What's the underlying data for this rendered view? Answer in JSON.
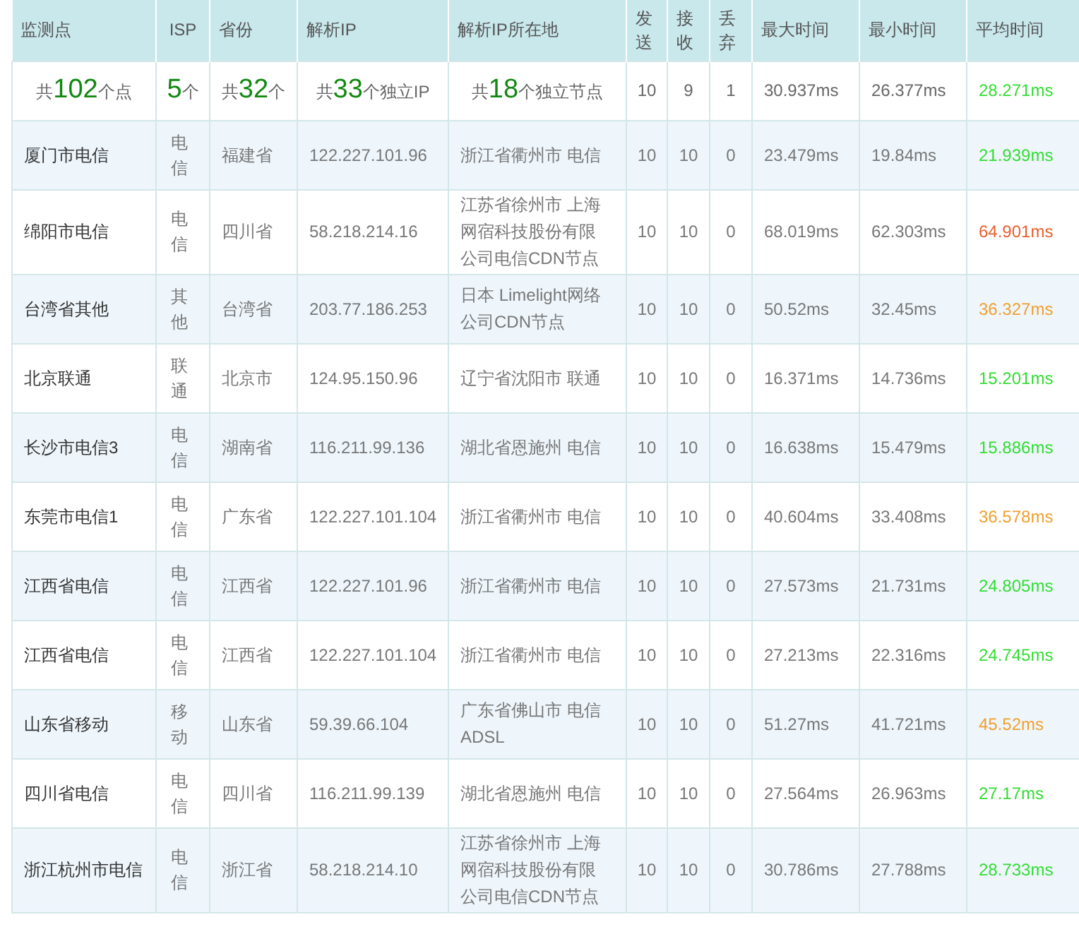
{
  "table": {
    "columns": [
      "监测点",
      "ISP",
      "省份",
      "解析IP",
      "解析IP所在地",
      "发送",
      "接收",
      "丢弃",
      "最大时间",
      "最小时间",
      "平均时间"
    ],
    "summary": {
      "points": {
        "prefix": "共",
        "count": "102",
        "suffix": "个点"
      },
      "isp": {
        "count": "5",
        "suffix": "个"
      },
      "provinces": {
        "prefix": "共",
        "count": "32",
        "suffix": "个"
      },
      "ips": {
        "prefix": "共",
        "count": "33",
        "suffix": "个独立IP"
      },
      "nodes": {
        "prefix": "共",
        "count": "18",
        "suffix": "个独立节点"
      },
      "sent": "10",
      "received": "9",
      "lost": "1",
      "max": "30.937ms",
      "min": "26.377ms",
      "avg": "28.271ms",
      "color": "#33dd33"
    },
    "rows": [
      {
        "point": "厦门市电信",
        "isp": "电信",
        "province": "福建省",
        "ip": "122.227.101.96",
        "location": "浙江省衢州市 电信",
        "sent": "10",
        "received": "10",
        "lost": "0",
        "max": "23.479ms",
        "min": "19.84ms",
        "avg": "21.939ms",
        "color": "#33dd33"
      },
      {
        "point": "绵阳市电信",
        "isp": "电信",
        "province": "四川省",
        "ip": "58.218.214.16",
        "location": "江苏省徐州市 上海网宿科技股份有限公司电信CDN节点",
        "sent": "10",
        "received": "10",
        "lost": "0",
        "max": "68.019ms",
        "min": "62.303ms",
        "avg": "64.901ms",
        "color": "#e8602c"
      },
      {
        "point": "台湾省其他",
        "isp": "其他",
        "province": "台湾省",
        "ip": "203.77.186.253",
        "location": "日本 Limelight网络公司CDN节点",
        "sent": "10",
        "received": "10",
        "lost": "0",
        "max": "50.52ms",
        "min": "32.45ms",
        "avg": "36.327ms",
        "color": "#f0a030"
      },
      {
        "point": "北京联通",
        "isp": "联通",
        "province": "北京市",
        "ip": "124.95.150.96",
        "location": "辽宁省沈阳市 联通",
        "sent": "10",
        "received": "10",
        "lost": "0",
        "max": "16.371ms",
        "min": "14.736ms",
        "avg": "15.201ms",
        "color": "#33dd33"
      },
      {
        "point": "长沙市电信3",
        "isp": "电信",
        "province": "湖南省",
        "ip": "116.211.99.136",
        "location": "湖北省恩施州 电信",
        "sent": "10",
        "received": "10",
        "lost": "0",
        "max": "16.638ms",
        "min": "15.479ms",
        "avg": "15.886ms",
        "color": "#33dd33"
      },
      {
        "point": "东莞市电信1",
        "isp": "电信",
        "province": "广东省",
        "ip": "122.227.101.104",
        "location": "浙江省衢州市 电信",
        "sent": "10",
        "received": "10",
        "lost": "0",
        "max": "40.604ms",
        "min": "33.408ms",
        "avg": "36.578ms",
        "color": "#f0a030"
      },
      {
        "point": "江西省电信",
        "isp": "电信",
        "province": "江西省",
        "ip": "122.227.101.96",
        "location": "浙江省衢州市 电信",
        "sent": "10",
        "received": "10",
        "lost": "0",
        "max": "27.573ms",
        "min": "21.731ms",
        "avg": "24.805ms",
        "color": "#33dd33"
      },
      {
        "point": "江西省电信",
        "isp": "电信",
        "province": "江西省",
        "ip": "122.227.101.104",
        "location": "浙江省衢州市 电信",
        "sent": "10",
        "received": "10",
        "lost": "0",
        "max": "27.213ms",
        "min": "22.316ms",
        "avg": "24.745ms",
        "color": "#33dd33"
      },
      {
        "point": "山东省移动",
        "isp": "移动",
        "province": "山东省",
        "ip": "59.39.66.104",
        "location": "广东省佛山市 电信ADSL",
        "sent": "10",
        "received": "10",
        "lost": "0",
        "max": "51.27ms",
        "min": "41.721ms",
        "avg": "45.52ms",
        "color": "#f0a030"
      },
      {
        "point": "四川省电信",
        "isp": "电信",
        "province": "四川省",
        "ip": "116.211.99.139",
        "location": "湖北省恩施州 电信",
        "sent": "10",
        "received": "10",
        "lost": "0",
        "max": "27.564ms",
        "min": "26.963ms",
        "avg": "27.17ms",
        "color": "#33dd33"
      },
      {
        "point": "浙江杭州市电信",
        "isp": "电信",
        "province": "浙江省",
        "ip": "58.218.214.10",
        "location": "江苏省徐州市 上海网宿科技股份有限公司电信CDN节点",
        "sent": "10",
        "received": "10",
        "lost": "0",
        "max": "30.786ms",
        "min": "27.788ms",
        "avg": "28.733ms",
        "color": "#33dd33"
      }
    ]
  }
}
